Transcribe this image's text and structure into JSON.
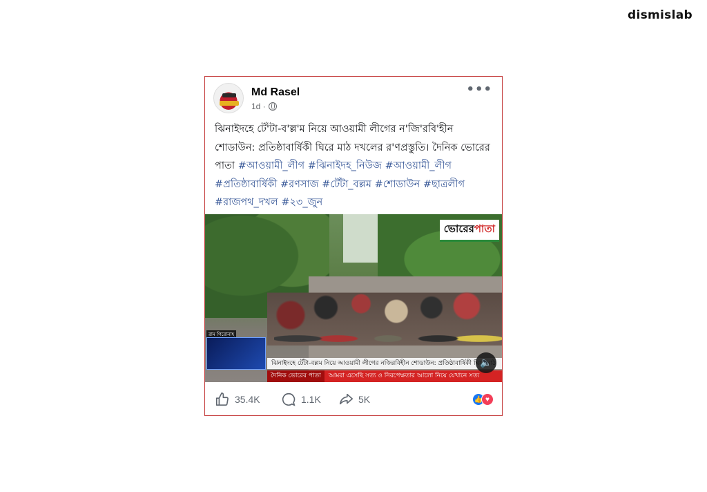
{
  "brand": {
    "logo_text": "dismislab"
  },
  "post": {
    "author": "Md Rasel",
    "time": "1d ·",
    "privacy_icon": "globe-icon",
    "more_icon": "•••",
    "text_main": "ঝিনাইদহে টেঁ'টা-ব'ল্ল'ম নিয়ে আওয়ামী লীগের ন'জি'রবি'হীন শোডাউন: প্রতিষ্ঠাবার্ষিকী ঘিরে মাঠ দখলের র'ণপ্রস্তুতি। দৈনিক ভোরের পাতা ",
    "hashtags": [
      "#আওয়ামী_লীগ",
      "#ঝিনাইদহ_নিউজ",
      "#আওয়ামী_লীগ",
      "#প্রতিষ্ঠাবার্ষিকী",
      "#রণসাজ",
      "#টেঁটা_বল্লম",
      "#শোডাউন",
      "#ছাত্রলীগ",
      "#রাজপথ_দখল",
      "#২৩_জুন"
    ]
  },
  "video": {
    "channel_logo_a": "ভোরের",
    "channel_logo_b": "পাতা",
    "inset_label": "রাম গিরোনাহ",
    "ticker_headline": "ঝিনাইদহে টেঁটা-বল্লম নিয়ে আওয়ামী লীগের নজিরবিহীন শোডাউন: প্রতিষ্ঠাবার্ষিকী ঘিরে মাঠ",
    "ticker_source": "দৈনিক ভোরের পাতা",
    "ticker_message": "আমরা এসেছি সত্য ও নিরপেক্ষতার আলো নিয়ে যেখানে সত্য",
    "sound_icon": "🔈"
  },
  "stats": {
    "likes": "35.4K",
    "comments": "1.1K",
    "shares": "5K"
  }
}
